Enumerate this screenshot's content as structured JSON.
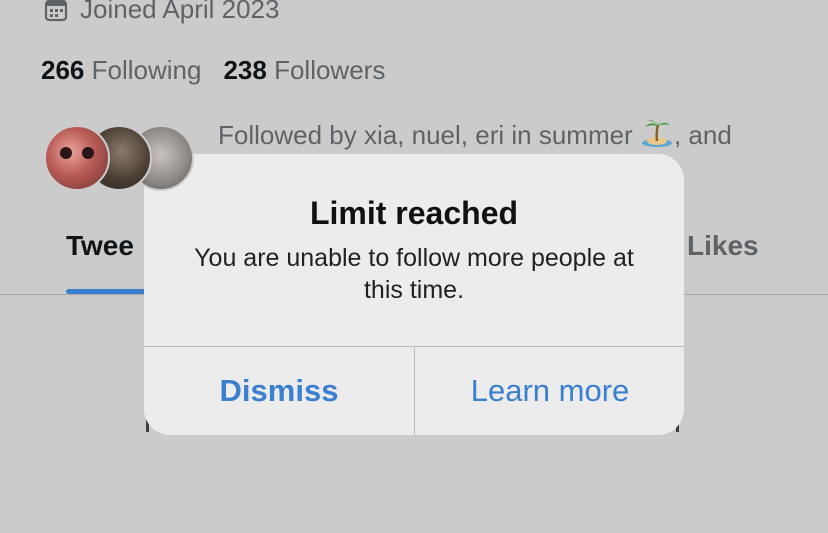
{
  "profile": {
    "joined": "Joined April 2023",
    "following_count": "266",
    "following_label": "Following",
    "followers_count": "238",
    "followers_label": "Followers",
    "followed_by": "Followed by xia, nuel, eri in summer",
    "followed_by_suffix": ", and"
  },
  "tabs": [
    {
      "label": "Twee"
    },
    {
      "label": "Likes"
    }
  ],
  "dialog": {
    "title": "Limit reached",
    "message": "You are unable to follow more people at this time.",
    "dismiss_label": "Dismiss",
    "learn_more_label": "Learn more"
  },
  "colors": {
    "accent": "#3a7fd0",
    "background": "#cbcbcb",
    "dialog_bg": "#ececec",
    "secondary_text": "#5e6368"
  },
  "icons": [
    "calendar-icon",
    "desert-island-emoji"
  ]
}
